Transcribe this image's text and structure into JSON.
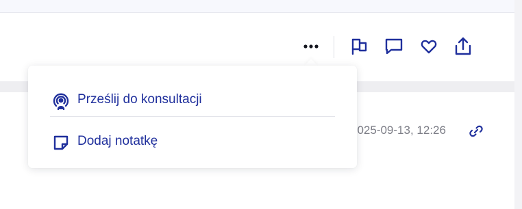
{
  "toolbar": {
    "icons": {
      "more": "more-horizontal-icon",
      "flag": "flag-icon",
      "comment": "comment-icon",
      "favorite": "heart-icon",
      "share": "share-upload-icon"
    }
  },
  "dropdown": {
    "items": [
      {
        "label": "Prześlij do konsultacji",
        "icon": "consultation-broadcast-icon"
      },
      {
        "label": "Dodaj notatkę",
        "icon": "note-icon"
      }
    ]
  },
  "entry": {
    "timestamp": "2025-09-13, 12:26",
    "status_icon": "link-icon"
  },
  "colors": {
    "accent": "#1f2f9c",
    "text_muted": "#7c7d86",
    "background": "#efeff2"
  }
}
